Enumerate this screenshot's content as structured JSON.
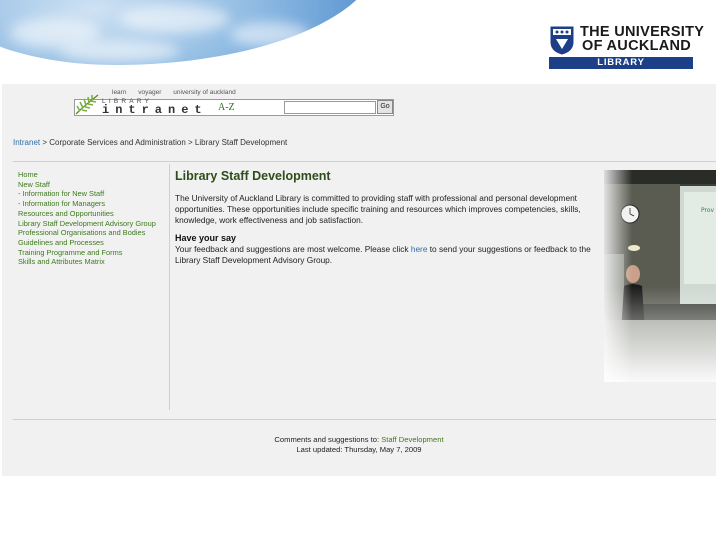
{
  "logo": {
    "line1": "THE UNIVERSITY",
    "line2": "OF AUCKLAND",
    "bar": "LIBRARY"
  },
  "intranet_header": {
    "top_links": [
      "learn",
      "voyager",
      "university of auckland"
    ],
    "library_text": "LIBRARY",
    "intranet_text": "intranet",
    "az_label": "A-Z",
    "search_value": "",
    "go_label": "Go"
  },
  "breadcrumb": {
    "items": [
      "Intranet",
      "Corporate Services and Administration",
      "Library Staff Development"
    ],
    "separator": " > "
  },
  "sidebar": {
    "items": [
      "Home",
      "New Staff",
      "- Information for New Staff",
      "- Information for Managers",
      "Resources and Opportunities",
      "Library Staff Development Advisory Group",
      "Professional Organisations and Bodies",
      "Guidelines and Processes",
      "Training Programme and Forms",
      "Skills and Attributes Matrix"
    ]
  },
  "main": {
    "title": "Library Staff Development",
    "intro": "The University of Auckland Library is committed to providing staff with professional and personal development opportunities. These opportunities include specific training and resources which improves competencies, skills, knowledge, work effectiveness and job satisfaction.",
    "subheading": "Have your say",
    "feedback_before": "Your feedback and suggestions are most welcome. Please click ",
    "feedback_link": "here",
    "feedback_after": " to send your suggestions or feedback to the Library Staff Development Advisory Group."
  },
  "footer": {
    "comments_prefix": "Comments and suggestions to: ",
    "comments_link": "Staff Development",
    "last_updated": "Last updated: Thursday, May 7, 2009"
  },
  "colors": {
    "nav_link": "#3d7a1d",
    "title": "#2d4d1a",
    "link_blue": "#2f6fa8",
    "logo_bar": "#1d3f88"
  }
}
